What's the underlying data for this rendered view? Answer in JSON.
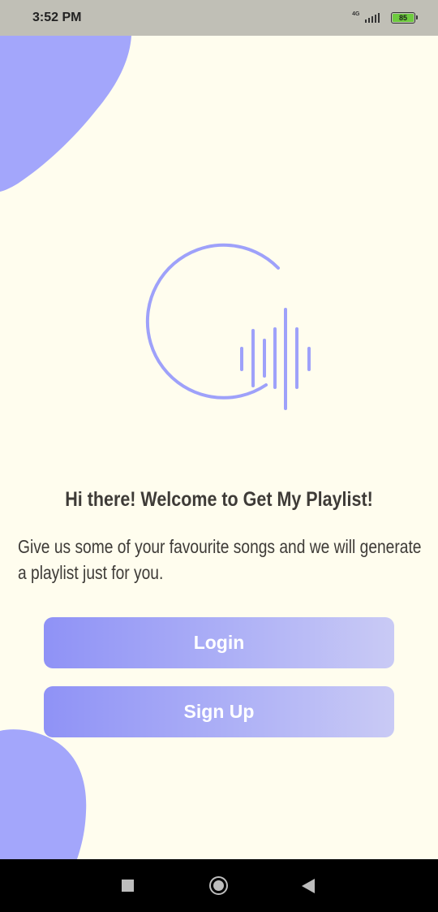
{
  "status_bar": {
    "time": "3:52 PM",
    "network_label": "4G",
    "battery_level": "85"
  },
  "welcome": {
    "title": "Hi there! Welcome to Get My Playlist!",
    "description": "Give us some of your favourite songs and we will generate a playlist just for you."
  },
  "buttons": {
    "login_label": "Login",
    "signup_label": "Sign Up"
  },
  "icons": {
    "logo": "g-soundwave-logo-icon",
    "nav_recent": "square-icon",
    "nav_home": "circle-icon",
    "nav_back": "triangle-back-icon"
  },
  "colors": {
    "background": "#fffdee",
    "accent": "#9ea1fa",
    "button_gradient_start": "#8f92f6",
    "button_gradient_end": "#c9caf5",
    "text": "#3e3b37"
  }
}
